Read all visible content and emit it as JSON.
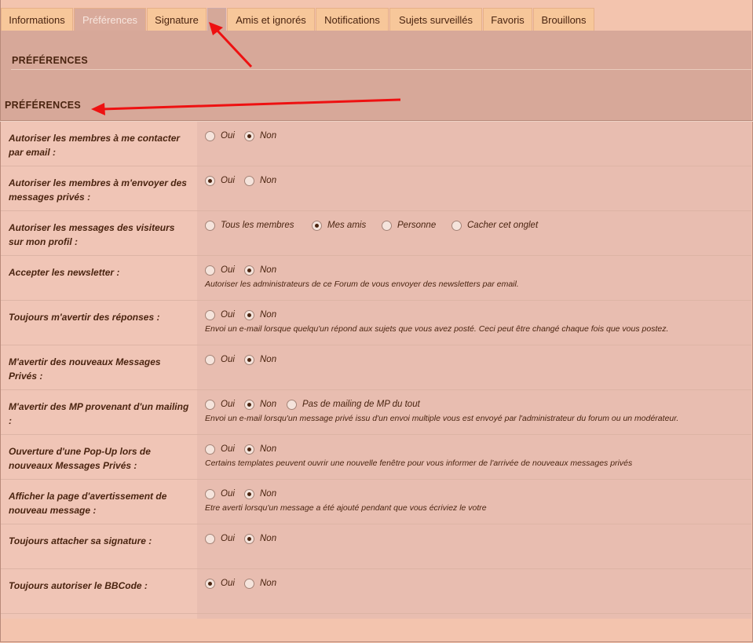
{
  "tabs": [
    {
      "label": "Informations"
    },
    {
      "label": "Préférences"
    },
    {
      "label": "Signature"
    },
    {
      "label": ""
    },
    {
      "label": "Amis et ignorés"
    },
    {
      "label": "Notifications"
    },
    {
      "label": "Sujets surveillés"
    },
    {
      "label": "Favoris"
    },
    {
      "label": "Brouillons"
    }
  ],
  "section_title": "PRÉFÉRENCES",
  "subsection_title": "PRÉFÉRENCES",
  "rows": [
    {
      "label": "Autoriser les membres à me contacter par email :",
      "options": [
        "Oui",
        "Non"
      ],
      "selected": "Non",
      "hint": ""
    },
    {
      "label": "Autoriser les membres à m'envoyer des messages privés :",
      "options": [
        "Oui",
        "Non"
      ],
      "selected": "Oui",
      "hint": ""
    },
    {
      "label": "Autoriser les messages des visiteurs sur mon profil :",
      "options": [
        "Tous les membres",
        "Mes amis",
        "Personne",
        "Cacher cet onglet"
      ],
      "selected": "Mes amis",
      "hint": ""
    },
    {
      "label": "Accepter les newsletter :",
      "options": [
        "Oui",
        "Non"
      ],
      "selected": "Non",
      "hint": "Autoriser les administrateurs de ce Forum de vous envoyer des newsletters par email."
    },
    {
      "label": "Toujours m'avertir des réponses :",
      "options": [
        "Oui",
        "Non"
      ],
      "selected": "Non",
      "hint": "Envoi un e-mail lorsque quelqu'un répond aux sujets que vous avez posté. Ceci peut être changé chaque fois que vous postez."
    },
    {
      "label": "M'avertir des nouveaux Messages Privés :",
      "options": [
        "Oui",
        "Non"
      ],
      "selected": "Non",
      "hint": ""
    },
    {
      "label": "M'avertir des MP provenant d'un mailing :",
      "options": [
        "Oui",
        "Non",
        "Pas de mailing de MP du tout"
      ],
      "selected": "Non",
      "hint": "Envoi un e-mail lorsqu'un message privé issu d'un envoi multiple vous est envoyé par l'administrateur du forum ou un modérateur."
    },
    {
      "label": "Ouverture d'une Pop-Up lors de nouveaux Messages Privés :",
      "options": [
        "Oui",
        "Non"
      ],
      "selected": "Non",
      "hint": "Certains templates peuvent ouvrir une nouvelle fenêtre pour vous informer de l'arrivée de nouveaux messages privés"
    },
    {
      "label": "Afficher la page d'avertissement de nouveau message :",
      "options": [
        "Oui",
        "Non"
      ],
      "selected": "Non",
      "hint": "Etre averti lorsqu'un message a été ajouté pendant que vous écriviez le votre"
    },
    {
      "label": "Toujours attacher sa signature :",
      "options": [
        "Oui",
        "Non"
      ],
      "selected": "Non",
      "hint": ""
    },
    {
      "label": "Toujours autoriser le BBCode :",
      "options": [
        "Oui",
        "Non"
      ],
      "selected": "Oui",
      "hint": ""
    }
  ],
  "colors": {
    "annotation_arrow": "#ee1111",
    "tab_active_bg": "#d9aa9b",
    "tab_bg": "#f7c79a"
  }
}
